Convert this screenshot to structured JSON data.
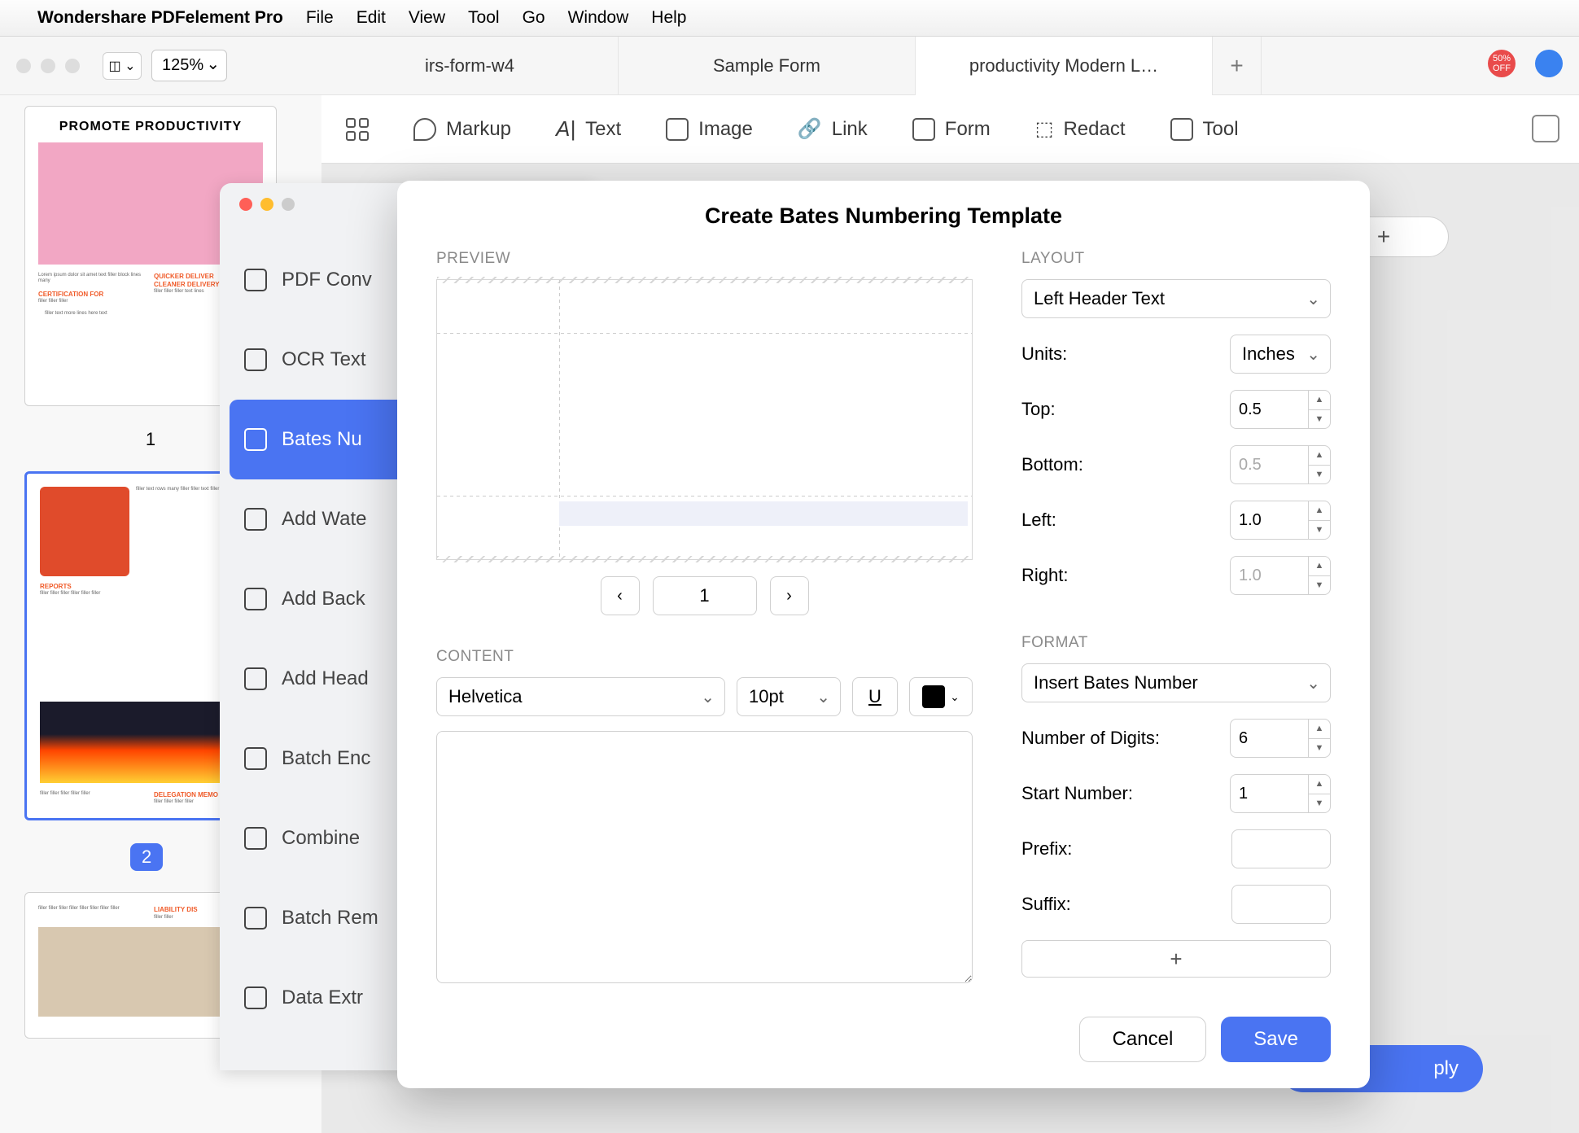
{
  "menubar": {
    "app": "Wondershare PDFelement Pro",
    "items": [
      "File",
      "Edit",
      "View",
      "Tool",
      "Go",
      "Window",
      "Help"
    ]
  },
  "topbar": {
    "zoom": "125%",
    "tabs": [
      "irs-form-w4",
      "Sample Form",
      "productivity Modern L…"
    ],
    "active_tab": 2
  },
  "ribbon": {
    "items": [
      "Markup",
      "Text",
      "Image",
      "Link",
      "Form",
      "Redact",
      "Tool"
    ]
  },
  "thumbs": {
    "title1": "PROMOTE PRODUCTIVITY",
    "heads": [
      "CERTIFICATION FOR",
      "QUICKER DELIVER",
      "CLEANER DELIVERY T",
      "DELEGATION MEMO",
      "REPORTS",
      "LIABILITY DIS"
    ],
    "pages": [
      "1",
      "2"
    ]
  },
  "sidepanel": {
    "items": [
      "PDF Conv",
      "OCR Text",
      "Bates Nu",
      "Add Wate",
      "Add Back",
      "Add Head",
      "Batch Enc",
      "Combine",
      "Batch Rem",
      "Data Extr"
    ],
    "active": 2
  },
  "modal": {
    "title": "Create Bates Numbering Template",
    "preview_label": "PREVIEW",
    "page": "1",
    "content_label": "CONTENT",
    "font": "Helvetica",
    "font_size": "10pt",
    "layout_label": "LAYOUT",
    "layout_select": "Left Header Text",
    "units_label": "Units:",
    "units": "Inches",
    "top_label": "Top:",
    "top": "0.5",
    "bottom_label": "Bottom:",
    "bottom": "0.5",
    "left_label": "Left:",
    "left": "1.0",
    "right_label": "Right:",
    "right": "1.0",
    "format_label": "FORMAT",
    "format_select": "Insert Bates Number",
    "digits_label": "Number of Digits:",
    "digits": "6",
    "start_label": "Start Number:",
    "start": "1",
    "prefix_label": "Prefix:",
    "prefix": "",
    "suffix_label": "Suffix:",
    "suffix": "",
    "cancel": "Cancel",
    "save": "Save"
  },
  "background": {
    "apply": "ply",
    "plus": "+"
  }
}
